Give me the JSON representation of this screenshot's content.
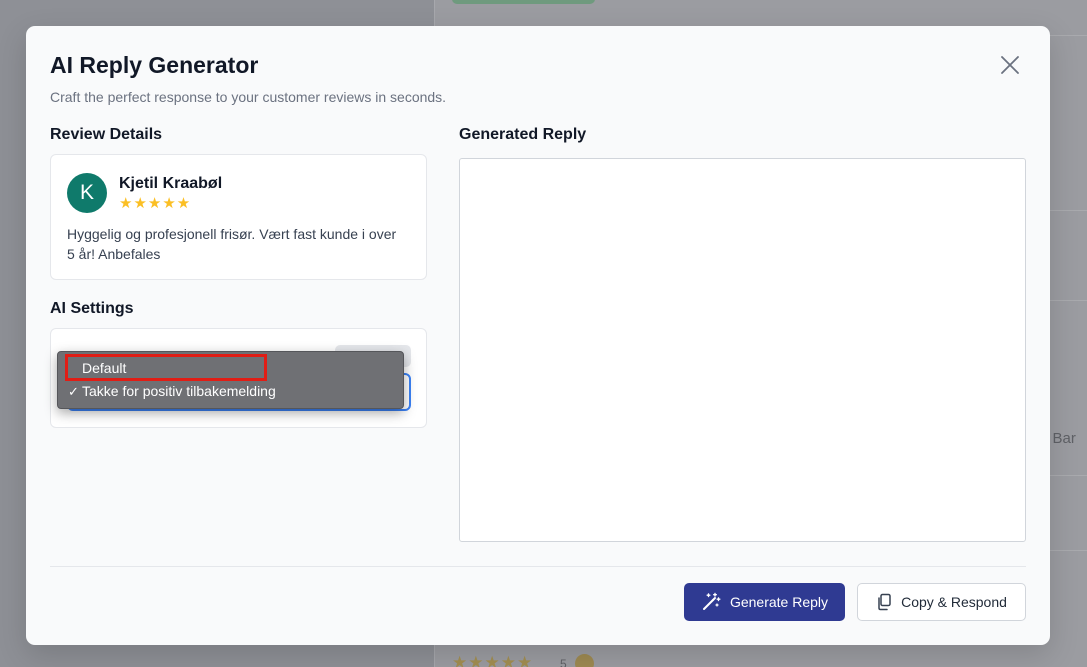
{
  "background": {
    "side_text": "e Bar",
    "stars": "★★★★★",
    "count": "5"
  },
  "modal": {
    "title": "AI Reply Generator",
    "subtitle": "Craft the perfect response to your customer reviews in seconds."
  },
  "review": {
    "section_label": "Review Details",
    "avatar_initial": "K",
    "name": "Kjetil Kraabøl",
    "rating": 5,
    "stars": "★★★★★",
    "text": "Hyggelig og profesjonell frisør. Vært fast kunde i over 5 år! Anbefales"
  },
  "settings": {
    "section_label": "AI Settings",
    "dropdown": {
      "options": [
        {
          "label": "Default",
          "selected": false
        },
        {
          "label": "Takke for positiv tilbakemelding",
          "selected": true
        }
      ],
      "check_mark": "✓"
    }
  },
  "reply": {
    "section_label": "Generated Reply",
    "value": ""
  },
  "actions": {
    "generate_label": "Generate Reply",
    "copy_label": "Copy & Respond"
  },
  "colors": {
    "accent": "#2f3a92",
    "avatar": "#0f7a6b",
    "star": "#fbbf24",
    "focus": "#3b82f6",
    "highlight": "#e11d15"
  }
}
